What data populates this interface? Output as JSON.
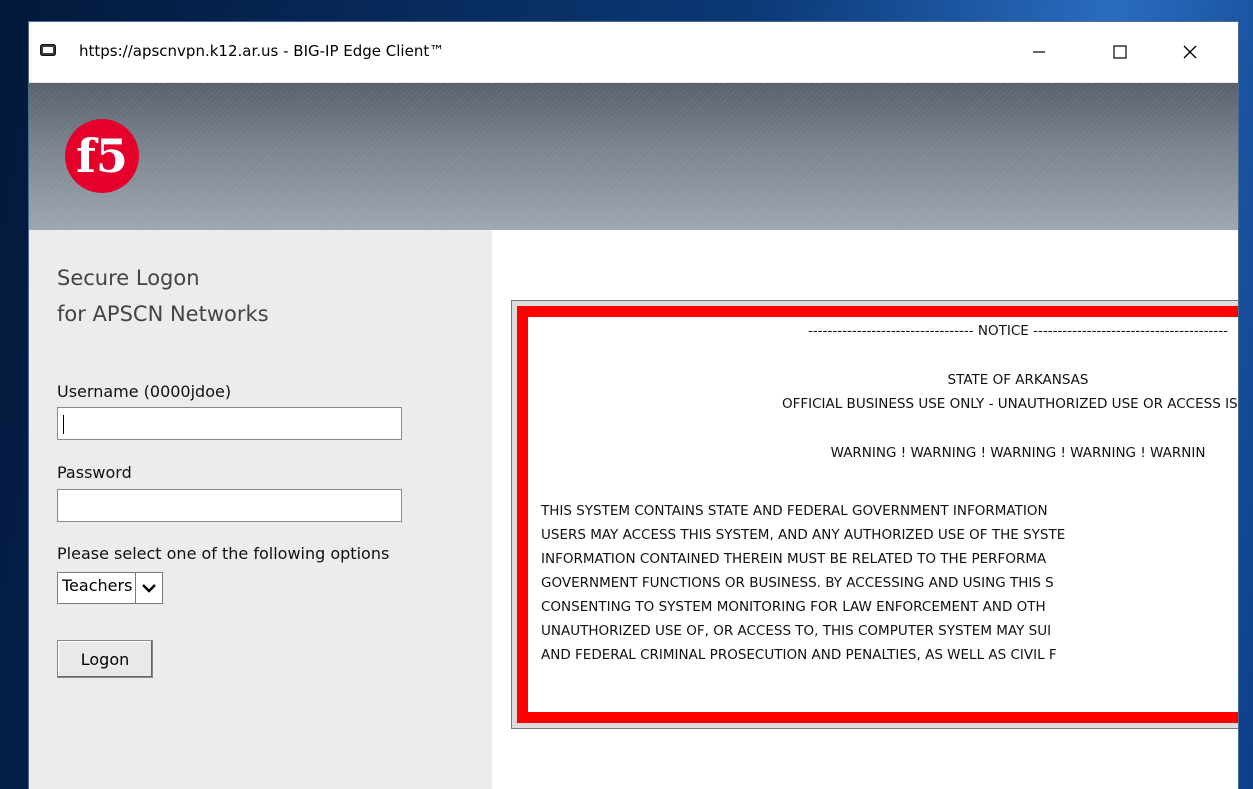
{
  "window": {
    "title": "https://apscnvpn.k12.ar.us - BIG-IP Edge Client™",
    "minimize_label": "—",
    "maximize_label": "☐",
    "close_label": "✕",
    "app_icon": "monitor-icon"
  },
  "banner": {
    "logo_text": "f5",
    "logo_color": "#e4002b"
  },
  "login": {
    "heading_line1": "Secure Logon",
    "heading_line2": "for APSCN Networks",
    "username_label": "Username (0000jdoe)",
    "username_value": "",
    "password_label": "Password",
    "password_value": "",
    "select_label": "Please select one of the following options",
    "select_value": "Teachers",
    "logon_button": "Logon"
  },
  "notice": {
    "border_color": "#ff0000",
    "header": "---------------------------------- NOTICE ----------------------------------------",
    "state": "STATE OF ARKANSAS",
    "official": "OFFICIAL BUSINESS USE ONLY - UNAUTHORIZED   USE OR ACCESS  IS PI",
    "warning": "WARNING  ! WARNING  ! WARNING  ! WARNING  ! WARNIN",
    "body": [
      "THIS SYSTEM  CONTAINS STATE  AND FEDERAL  GOVERNMENT   INFORMATION",
      "USERS MAY ACCESS THIS SYSTEM,  AND ANY AUTHORIZED  USE OF THE SYSTE",
      "INFORMATION CONTAINED THEREIN  MUST BE RELATED TO THE PERFORMA",
      "GOVERNMENT  FUNCTIONS OR BUSINESS. BY ACCESSING AND USING THIS S",
      "CONSENTING  TO SYSTEM MONITORING FOR LAW ENFORCEMENT  AND OTH",
      "UNAUTHORIZED   USE OF, OR ACCESS TO, THIS COMPUTER SYSTEM  MAY SUI",
      "AND FEDERAL CRIMINAL PROSECUTION AND PENALTIES,  AS WELL AS CIVIL F"
    ]
  }
}
